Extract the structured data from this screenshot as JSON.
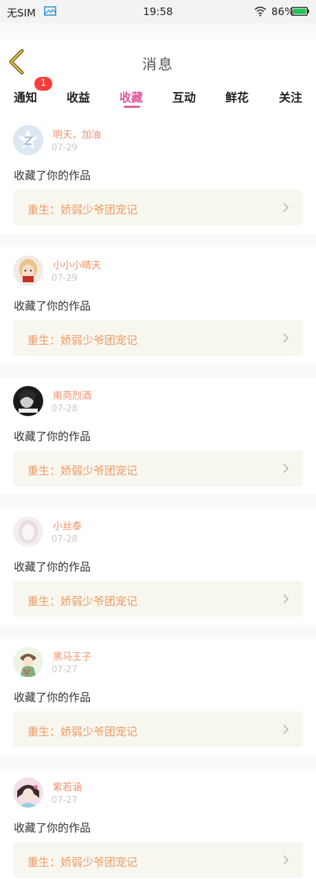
{
  "statusbar": {
    "carrier": "无SIM",
    "time": "19:58",
    "battery": "86%"
  },
  "navbar": {
    "title": "消息",
    "back_icon": "chevron-left-icon"
  },
  "tabs": [
    {
      "label": "通知"
    },
    {
      "label": "收益"
    },
    {
      "label": "收藏"
    },
    {
      "label": "互动"
    },
    {
      "label": "鲜花"
    },
    {
      "label": "关注"
    }
  ],
  "active_tab": "收藏",
  "notice_badge": "1",
  "colors": {
    "accent_pink": "#e0589d",
    "username_orange": "#f0906a",
    "work_title_orange": "#f29a5f",
    "badge_red": "#ff3b3b"
  },
  "items": [
    {
      "username": "明天，加油",
      "date": "07-29",
      "action": "收藏了你的作品",
      "work_title": "重生：娇弱少爷团宠记"
    },
    {
      "username": "小小小晴天",
      "date": "07-29",
      "action": "收藏了你的作品",
      "work_title": "重生：娇弱少爷团宠记"
    },
    {
      "username": "南苘烈酒",
      "date": "07-28",
      "action": "收藏了你的作品",
      "work_title": "重生：娇弱少爷团宠记"
    },
    {
      "username": "小丝泰",
      "date": "07-28",
      "action": "收藏了你的作品",
      "work_title": "重生：娇弱少爷团宠记"
    },
    {
      "username": "黑马王子",
      "date": "07-27",
      "action": "收藏了你的作品",
      "work_title": "重生：娇弱少爷团宠记"
    },
    {
      "username": "紫若涵",
      "date": "07-27",
      "action": "收藏了你的作品",
      "work_title": "重生：娇弱少爷团宠记"
    }
  ]
}
